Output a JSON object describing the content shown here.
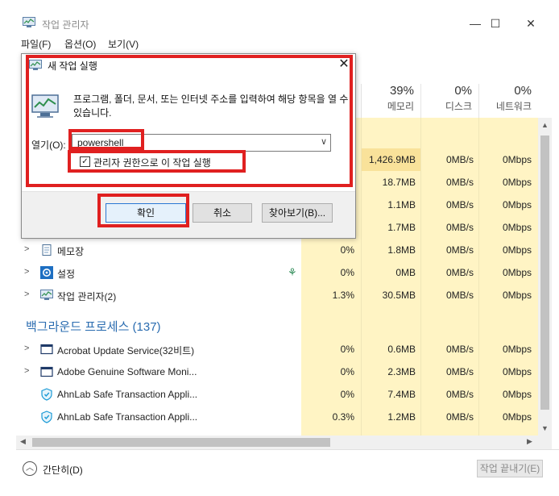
{
  "window": {
    "title": "작업 관리자",
    "minimize": "—",
    "maximize": "☐",
    "close": "✕"
  },
  "menu": [
    "파일(F)",
    "옵션(O)",
    "보기(V)"
  ],
  "columns": [
    {
      "pct": "39%",
      "label": "메모리"
    },
    {
      "pct": "0%",
      "label": "디스크"
    },
    {
      "pct": "0%",
      "label": "네트워크"
    }
  ],
  "apps_rows": [
    {
      "cpu": "",
      "mem": "1,426.9MB",
      "disk": "0MB/s",
      "net": "0Mbps"
    },
    {
      "cpu": "",
      "mem": "18.7MB",
      "disk": "0MB/s",
      "net": "0Mbps"
    },
    {
      "cpu": "",
      "mem": "1.1MB",
      "disk": "0MB/s",
      "net": "0Mbps"
    },
    {
      "cpu": "",
      "mem": "1.7MB",
      "disk": "0MB/s",
      "net": "0Mbps"
    },
    {
      "name": "메모장",
      "cpu": "0%",
      "mem": "1.8MB",
      "disk": "0MB/s",
      "net": "0Mbps",
      "icon": "notepad-icon"
    },
    {
      "name": "설정",
      "cpu": "0%",
      "mem": "0MB",
      "disk": "0MB/s",
      "net": "0Mbps",
      "icon": "settings-gear-icon"
    },
    {
      "name": "작업 관리자(2)",
      "cpu": "1.3%",
      "mem": "30.5MB",
      "disk": "0MB/s",
      "net": "0Mbps",
      "icon": "task-manager-icon"
    }
  ],
  "background_section": "백그라운드 프로세스 (137)",
  "bg_rows": [
    {
      "name": "Acrobat Update Service(32비트)",
      "cpu": "0%",
      "mem": "0.6MB",
      "disk": "0MB/s",
      "net": "0Mbps"
    },
    {
      "name": "Adobe Genuine Software Moni...",
      "cpu": "0%",
      "mem": "2.3MB",
      "disk": "0MB/s",
      "net": "0Mbps"
    },
    {
      "name": "AhnLab Safe Transaction Appli...",
      "cpu": "0%",
      "mem": "7.4MB",
      "disk": "0MB/s",
      "net": "0Mbps"
    },
    {
      "name": "AhnLab Safe Transaction Appli...",
      "cpu": "0.3%",
      "mem": "1.2MB",
      "disk": "0MB/s",
      "net": "0Mbps"
    }
  ],
  "footer": {
    "collapse": "간단히(D)",
    "end_task": "작업 끝내기(E)"
  },
  "run_dialog": {
    "title": "새 작업 실행",
    "description": "프로그램, 폴더, 문서, 또는 인터넷 주소를 입력하여 해당 항목을 열 수 있습니다.",
    "open_label": "열기(O):",
    "input_value": "powershell",
    "admin_checkbox_label": "관리자 권한으로 이 작업 실행",
    "admin_checked": true,
    "ok": "확인",
    "cancel": "취소",
    "browse": "찾아보기(B)..."
  },
  "colors": {
    "annotation_red": "#e02020",
    "section_blue": "#2a6cb0",
    "heat_light": "#fff4c4",
    "heat_strong": "#f9e29a"
  }
}
